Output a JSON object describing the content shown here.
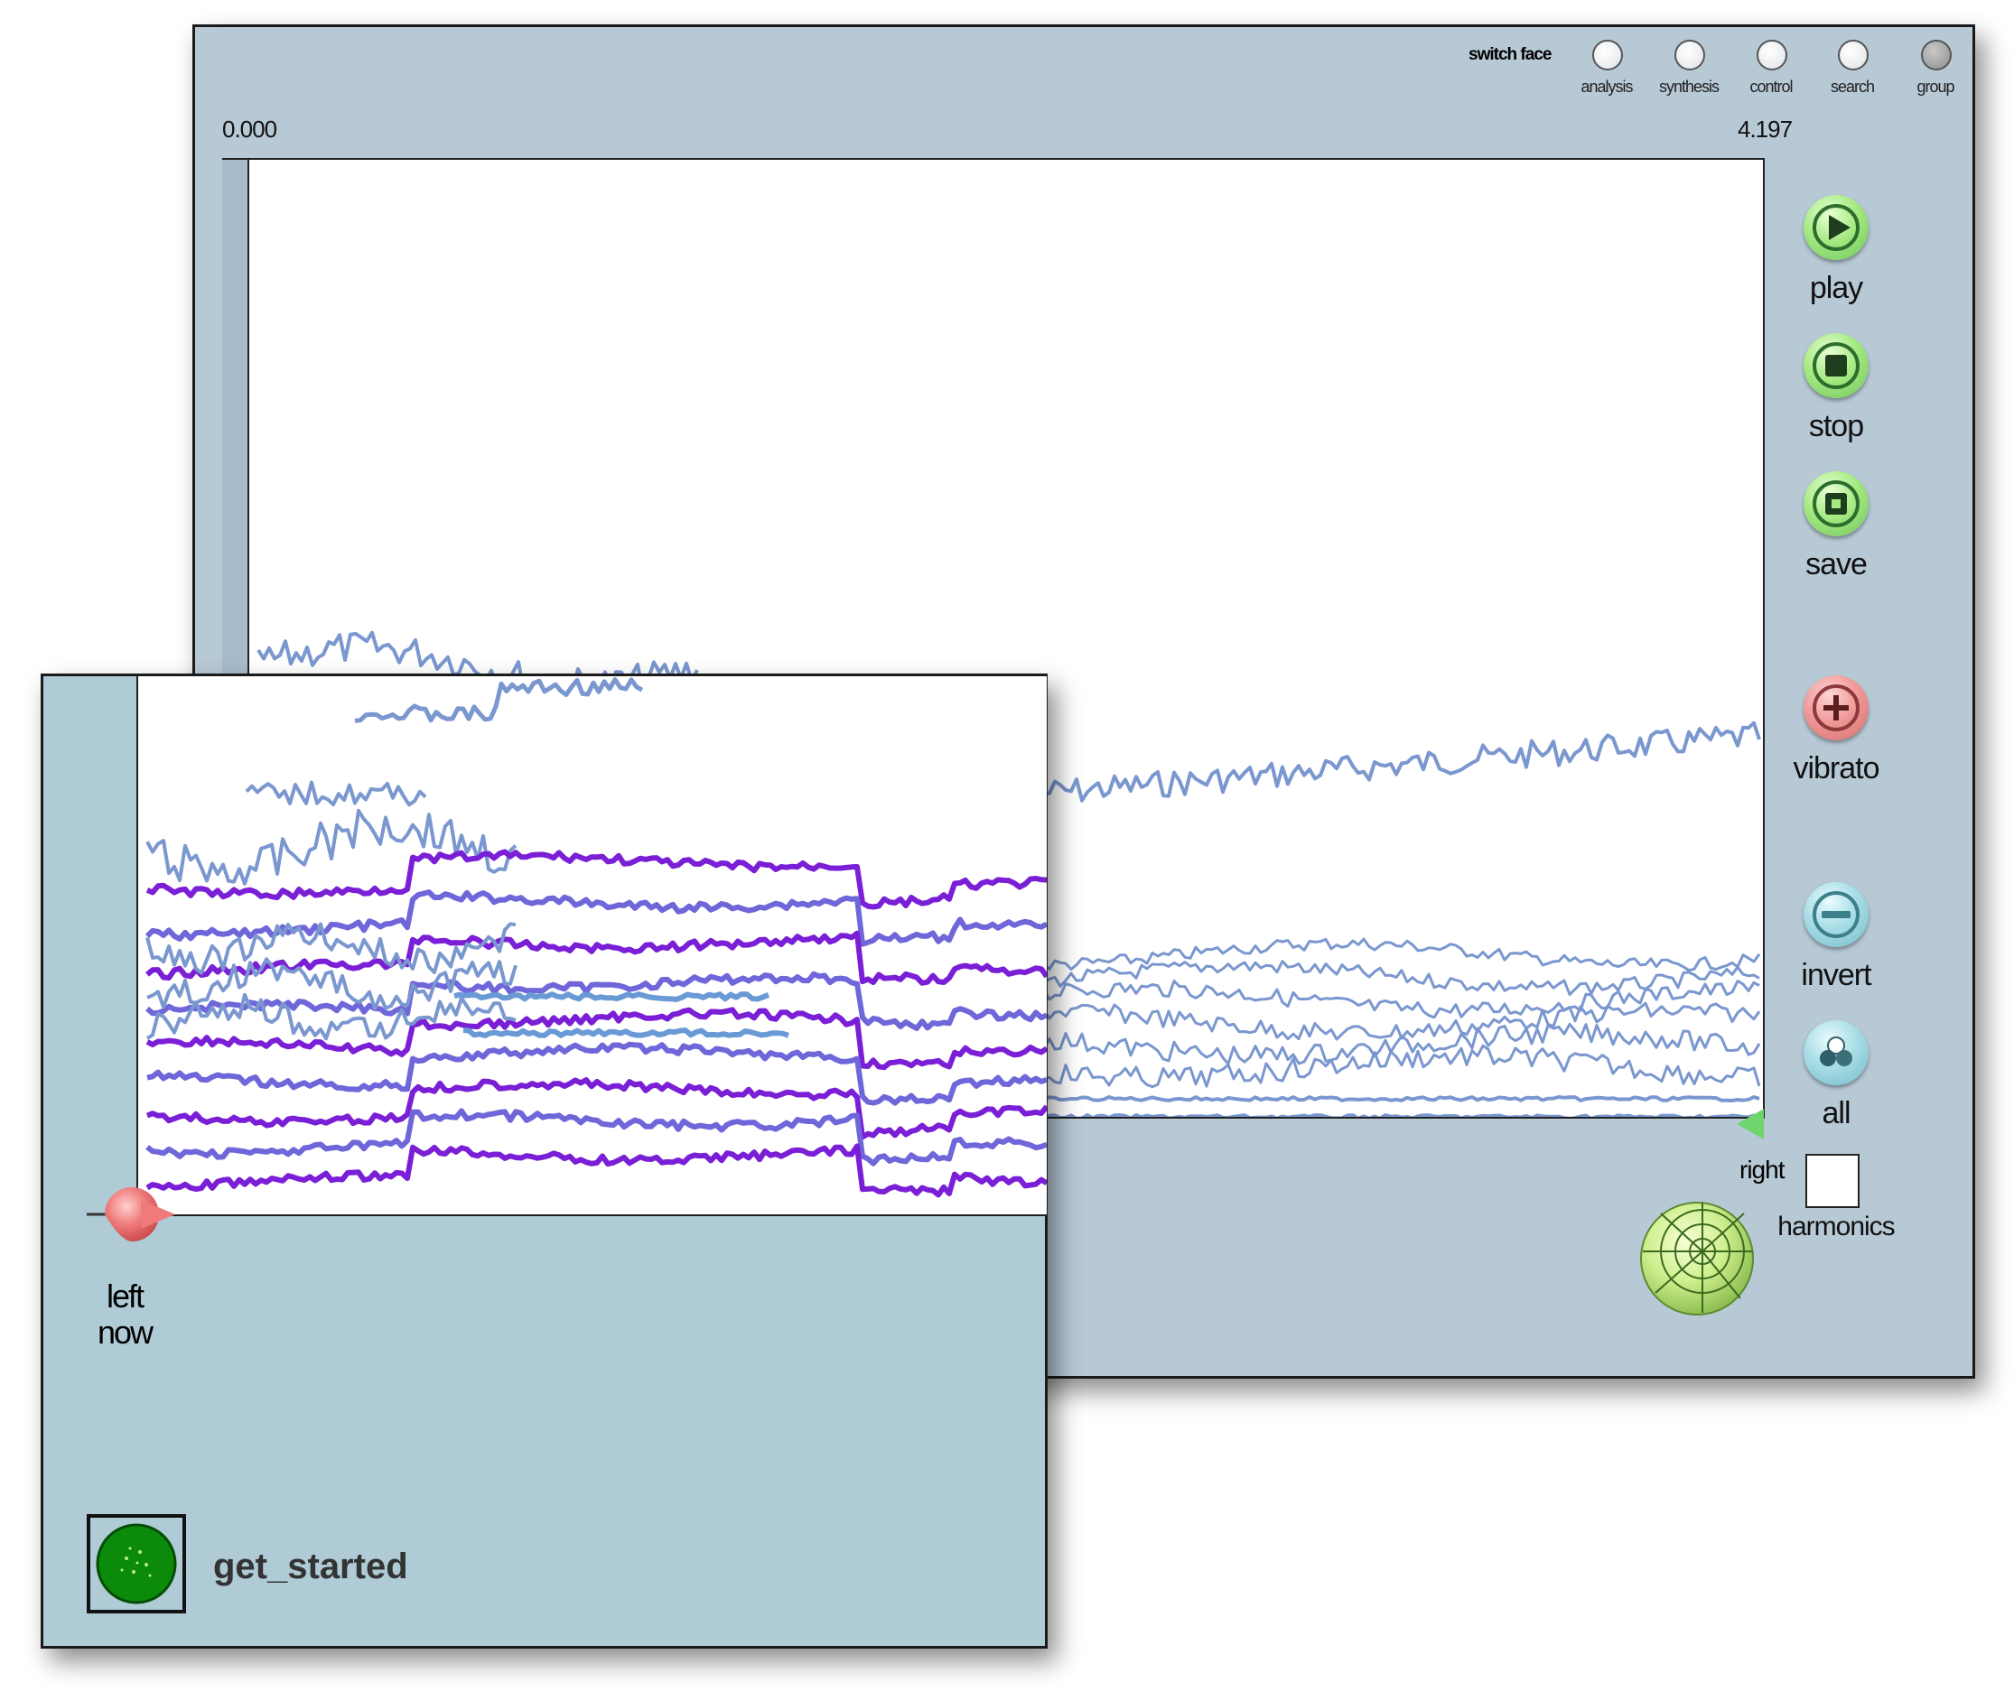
{
  "header": {
    "switch_face_label": "switch face",
    "faces": [
      {
        "label": "analysis",
        "selected": false
      },
      {
        "label": "synthesis",
        "selected": false
      },
      {
        "label": "control",
        "selected": false
      },
      {
        "label": "search",
        "selected": false
      },
      {
        "label": "group",
        "selected": true
      }
    ]
  },
  "timeline": {
    "start": "0.000",
    "end": "4.197"
  },
  "controls": {
    "play": "play",
    "stop": "stop",
    "save": "save",
    "vibrato": "vibrato",
    "invert": "invert",
    "all": "all",
    "right": "right",
    "harmonics": "harmonics"
  },
  "overlay": {
    "left_label": "left",
    "now_label": "now",
    "get_started": "get_started"
  },
  "colors": {
    "panel_main": "#b8c9d6",
    "panel_overlay": "#aecbd6",
    "trace_blue": "#7a97cf",
    "trace_violet": "#7a1fd6",
    "button_green": "#a6ea83",
    "button_pink": "#f09a9a",
    "button_cyan": "#a8dde6",
    "marker_red": "#e86a6a"
  },
  "icons": [
    "play-icon",
    "stop-icon",
    "save-icon",
    "vibrato-icon",
    "invert-icon",
    "all-icon",
    "globe-icon",
    "left-marker-icon",
    "right-marker-icon",
    "get-started-icon"
  ]
}
